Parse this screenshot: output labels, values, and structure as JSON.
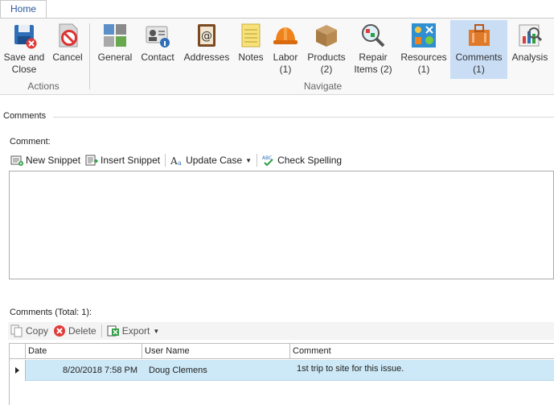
{
  "ribbon": {
    "tab_home": "Home",
    "actions": {
      "group_label": "Actions",
      "save_close": [
        "Save and",
        "Close"
      ],
      "cancel": "Cancel"
    },
    "navigate": {
      "group_label": "Navigate",
      "items": [
        {
          "line1": "General",
          "line2": ""
        },
        {
          "line1": "Contact",
          "line2": ""
        },
        {
          "line1": "Addresses",
          "line2": ""
        },
        {
          "line1": "Notes",
          "line2": ""
        },
        {
          "line1": "Labor",
          "line2": "(1)"
        },
        {
          "line1": "Products",
          "line2": "(2)"
        },
        {
          "line1": "Repair",
          "line2": "Items (2)"
        },
        {
          "line1": "Resources",
          "line2": "(1)"
        },
        {
          "line1": "Comments",
          "line2": "(1)"
        },
        {
          "line1": "Analysis",
          "line2": ""
        }
      ],
      "selected_index": 8
    }
  },
  "section": {
    "title": "Comments"
  },
  "editor": {
    "label": "Comment:",
    "toolbar": {
      "new_snippet": "New Snippet",
      "insert_snippet": "Insert Snippet",
      "update_case": "Update Case",
      "check_spelling": "Check Spelling"
    },
    "value": ""
  },
  "list": {
    "label": "Comments (Total: 1):",
    "toolbar": {
      "copy": "Copy",
      "delete": "Delete",
      "export": "Export"
    },
    "columns": [
      "Date",
      "User Name",
      "Comment"
    ],
    "rows": [
      {
        "date": "8/20/2018 7:58 PM",
        "user": "Doug Clemens",
        "comment": "1st trip to site for this issue."
      }
    ]
  },
  "colors": {
    "accent": "#2b579a",
    "selected_bg": "#c9ddf5",
    "row_selected": "#cde8f6"
  }
}
